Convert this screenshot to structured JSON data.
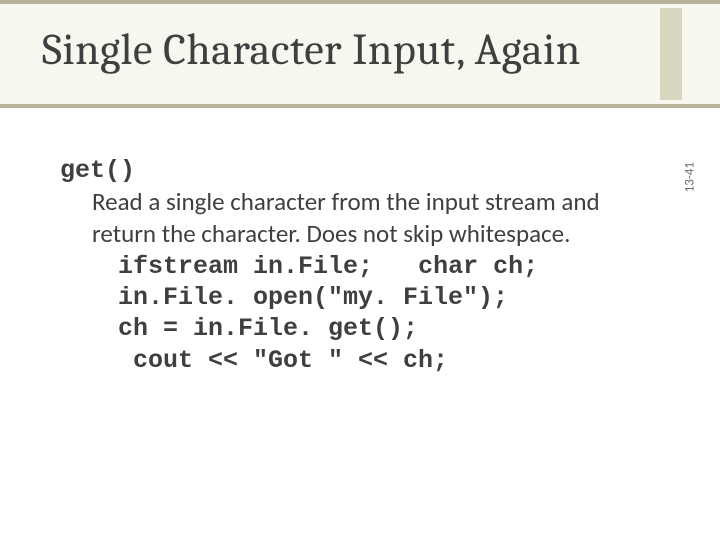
{
  "title": "Single Character Input, Again",
  "func": "get()",
  "desc1": "Read a single character from the input stream and",
  "desc2": "return the character. Does not skip whitespace.",
  "code": {
    "l1a": "ifstream in.File;   ",
    "l1b": "char ch;",
    "l2": "in.File. open(\"my. File\");",
    "l3": "ch = in.File. get();",
    "l4": " cout << \"Got \" << ch;"
  },
  "pagenum": "13-41"
}
